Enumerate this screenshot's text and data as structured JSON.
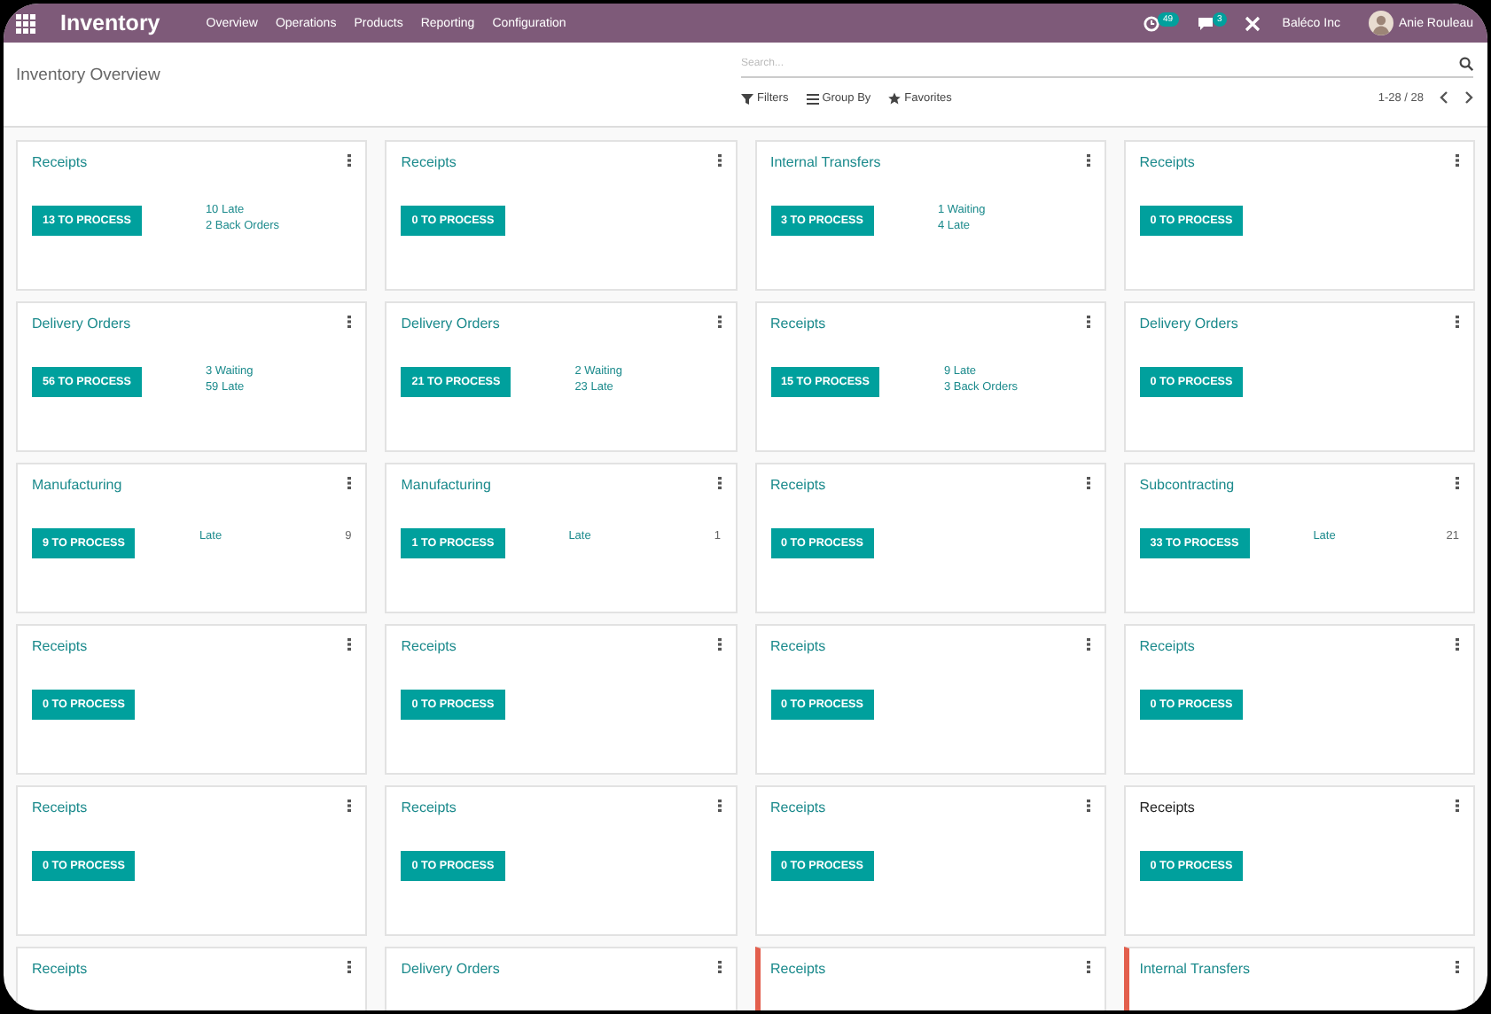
{
  "navbar": {
    "app_name": "Inventory",
    "menu": [
      "Overview",
      "Operations",
      "Products",
      "Reporting",
      "Configuration"
    ],
    "activity_count": "49",
    "message_count": "3",
    "company": "Baléco Inc",
    "user": "Anie Rouleau"
  },
  "control_panel": {
    "title": "Inventory Overview",
    "search": {
      "placeholder": "Search..."
    },
    "filters": [
      "Filters",
      "Group By",
      "Favorites"
    ],
    "pager": "1-28 / 28"
  },
  "cards": [
    {
      "title": "Receipts",
      "button": "13 TO PROCESS",
      "stats": [
        {
          "label": "10 Late"
        },
        {
          "label": "2 Back Orders"
        }
      ],
      "flagged": false,
      "hovered": false
    },
    {
      "title": "Receipts",
      "button": "0 TO PROCESS",
      "flagged": false,
      "hovered": false
    },
    {
      "title": "Internal Transfers",
      "button": "3 TO PROCESS",
      "stats": [
        {
          "label": "1 Waiting"
        },
        {
          "label": "4 Late"
        }
      ],
      "flagged": false,
      "hovered": false
    },
    {
      "title": "Receipts",
      "button": "0 TO PROCESS",
      "flagged": false,
      "hovered": false
    },
    {
      "title": "Delivery Orders",
      "button": "56 TO PROCESS",
      "stats": [
        {
          "label": "3 Waiting"
        },
        {
          "label": "59 Late"
        }
      ],
      "flagged": false,
      "hovered": false
    },
    {
      "title": "Delivery Orders",
      "button": "21 TO PROCESS",
      "stats": [
        {
          "label": "2 Waiting"
        },
        {
          "label": "23 Late"
        }
      ],
      "flagged": false,
      "hovered": false
    },
    {
      "title": "Receipts",
      "button": "15 TO PROCESS",
      "stats": [
        {
          "label": "9 Late"
        },
        {
          "label": "3 Back Orders"
        }
      ],
      "flagged": false,
      "hovered": false
    },
    {
      "title": "Delivery Orders",
      "button": "0 TO PROCESS",
      "flagged": false,
      "hovered": false
    },
    {
      "title": "Manufacturing",
      "button": "9 TO PROCESS",
      "stats": [
        {
          "label": "Late",
          "count": "9"
        }
      ],
      "flagged": false,
      "hovered": false
    },
    {
      "title": "Manufacturing",
      "button": "1 TO PROCESS",
      "stats": [
        {
          "label": "Late",
          "count": "1"
        }
      ],
      "flagged": false,
      "hovered": false
    },
    {
      "title": "Receipts",
      "button": "0 TO PROCESS",
      "flagged": false,
      "hovered": false
    },
    {
      "title": "Subcontracting",
      "button": "33 TO PROCESS",
      "stats": [
        {
          "label": "Late",
          "count": "21"
        }
      ],
      "flagged": false,
      "hovered": false
    },
    {
      "title": "Receipts",
      "button": "0 TO PROCESS",
      "flagged": false,
      "hovered": false
    },
    {
      "title": "Receipts",
      "button": "0 TO PROCESS",
      "flagged": false,
      "hovered": false
    },
    {
      "title": "Receipts",
      "button": "0 TO PROCESS",
      "flagged": false,
      "hovered": false
    },
    {
      "title": "Receipts",
      "button": "0 TO PROCESS",
      "flagged": false,
      "hovered": false
    },
    {
      "title": "Receipts",
      "button": "0 TO PROCESS",
      "flagged": false,
      "hovered": false
    },
    {
      "title": "Receipts",
      "button": "0 TO PROCESS",
      "flagged": false,
      "hovered": false
    },
    {
      "title": "Receipts",
      "button": "0 TO PROCESS",
      "flagged": false,
      "hovered": false
    },
    {
      "title": "Receipts",
      "button": "0 TO PROCESS",
      "flagged": false,
      "hovered": true
    },
    {
      "title": "Receipts",
      "flagged": false,
      "hovered": false
    },
    {
      "title": "Delivery Orders",
      "flagged": false,
      "hovered": false
    },
    {
      "title": "Receipts",
      "flagged": true,
      "hovered": false
    },
    {
      "title": "Internal Transfers",
      "flagged": true,
      "hovered": false
    }
  ]
}
